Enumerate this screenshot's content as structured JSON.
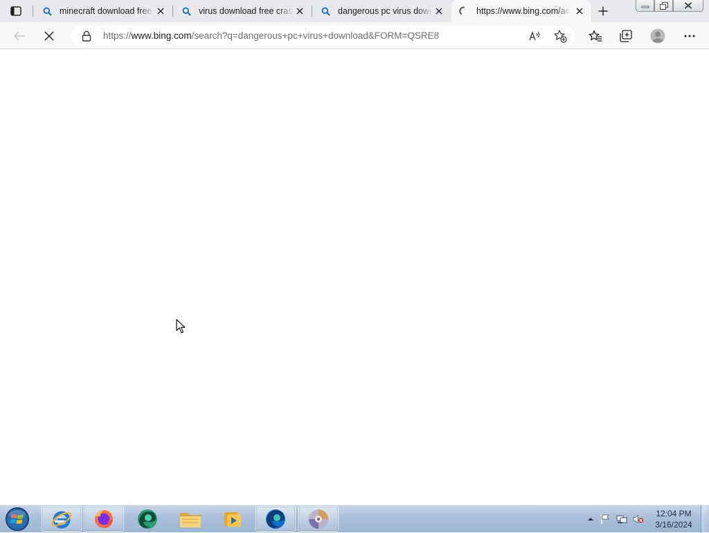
{
  "browser": {
    "tabs": [
      {
        "title": "minecraft download free",
        "favicon": "search-icon"
      },
      {
        "title": "virus download free crash",
        "favicon": "search-icon"
      },
      {
        "title": "dangerous pc virus download",
        "favicon": "search-icon"
      },
      {
        "title": "https://www.bing.com/ac",
        "favicon": "loading-spinner-icon",
        "active": true
      }
    ],
    "address_bar": {
      "url_prefix": "https://",
      "url_host": "www.bing.com",
      "url_rest": "/search?q=dangerous+pc+virus+download&FORM=QSRE8"
    }
  },
  "taskbar": {
    "apps": [
      "internet-explorer",
      "firefox",
      "edge-dev",
      "file-explorer",
      "media-player",
      "edge",
      "dvd-player"
    ],
    "clock": {
      "time": "12:04 PM",
      "date": "3/16/2024"
    }
  },
  "colors": {
    "accent": "#0f6cbd",
    "titlebar": "#e7e9ec",
    "toolbar": "#f7f7f7"
  }
}
